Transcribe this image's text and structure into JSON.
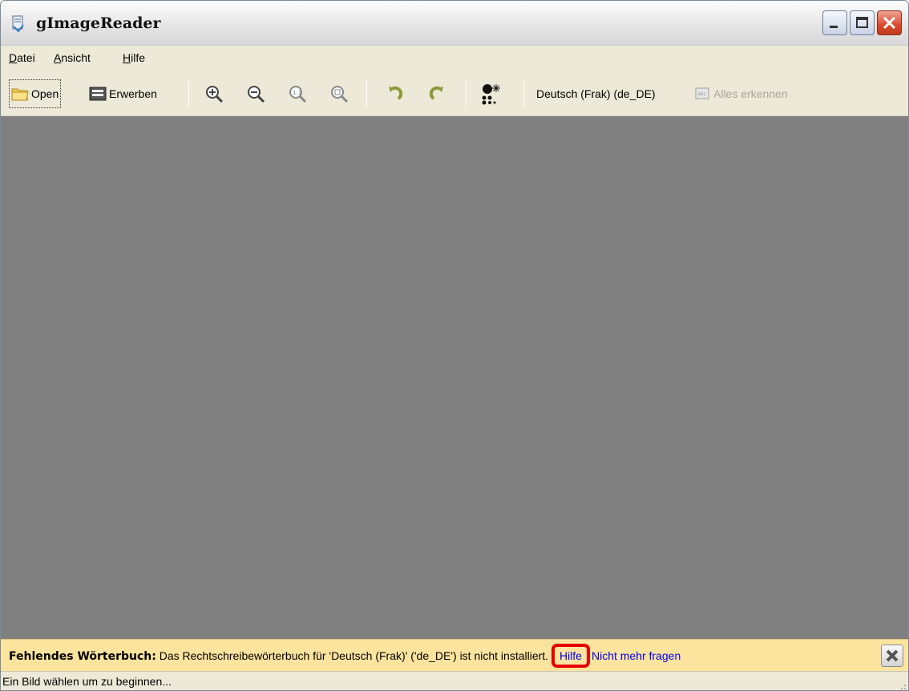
{
  "window": {
    "title": "gImageReader"
  },
  "menu": [
    {
      "label_mnem": "D",
      "label_rest": "atei"
    },
    {
      "label_mnem": "A",
      "label_rest": "nsicht"
    },
    {
      "label_mnem": "H",
      "label_rest": "ilfe"
    }
  ],
  "toolbar": {
    "open_label": "Open",
    "acquire_label": "Erwerben",
    "language_label": "Deutsch (Frak) (de_DE)",
    "recognize_all_label": "Alles erkennen"
  },
  "infobar": {
    "heading": "Fehlendes Wörterbuch:",
    "message": " Das Rechtschreibewörterbuch für 'Deutsch (Frak)' ('de_DE') ist nicht installiert. ",
    "help_link": "Hilfe",
    "dont_ask_link": "Nicht mehr fragen"
  },
  "statusbar": {
    "text": "Ein Bild wählen um zu beginnen..."
  },
  "colors": {
    "infobar_bg": "#fce39e",
    "highlight": "#e60000",
    "canvas": "#808080",
    "link": "#0000ee"
  }
}
